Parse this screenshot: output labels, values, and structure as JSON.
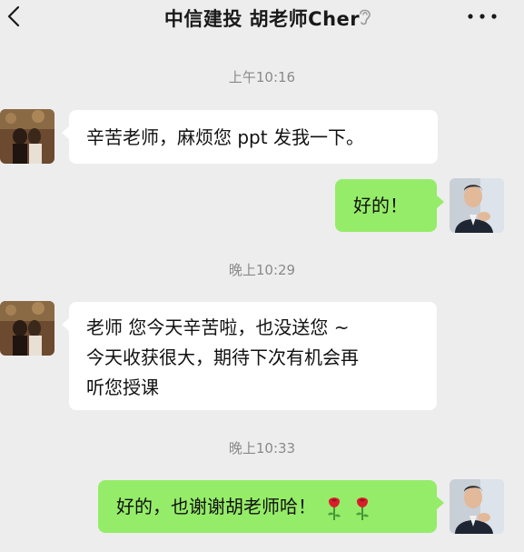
{
  "header": {
    "title": "中信建投 胡老师Cher"
  },
  "chat": {
    "timestamps": [
      "上午10:16",
      "晚上10:29",
      "晚上10:33"
    ],
    "messages": [
      {
        "from": "contact",
        "text": "辛苦老师，麻烦您 ppt 发我一下。"
      },
      {
        "from": "self",
        "text": "好的！"
      },
      {
        "from": "contact",
        "lines": [
          "老师 您今天辛苦啦，也没送您 ~",
          "今天收获很大，期待下次有机会再",
          "听您授课"
        ]
      },
      {
        "from": "self",
        "text": "好的，也谢谢胡老师哈！",
        "emoji": [
          "rose-icon",
          "rose-icon"
        ]
      }
    ]
  },
  "colors": {
    "background": "#ededed",
    "incoming_bubble": "#ffffff",
    "outgoing_bubble": "#95ec69",
    "timestamp_text": "#8a8a8a"
  }
}
